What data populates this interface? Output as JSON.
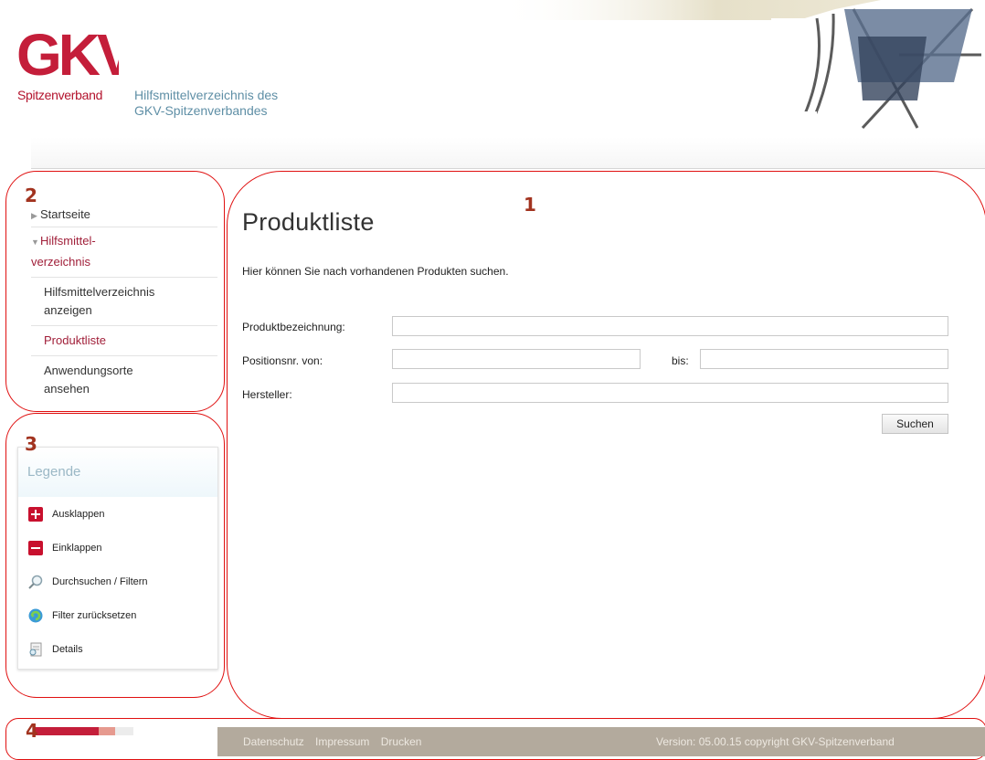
{
  "header": {
    "logo_text": "GKV",
    "org_name": "Spitzenverband",
    "site_title_line1": "Hilfsmittelverzeichnis des",
    "site_title_line2": "GKV-Spitzenverbandes"
  },
  "annotations": [
    "1",
    "2",
    "3",
    "4"
  ],
  "sidebar": {
    "items": [
      {
        "label": "Startseite",
        "state": "collapsed"
      },
      {
        "label_line1": "Hilfsmittel-",
        "label_line2": "verzeichnis",
        "state": "expanded"
      },
      {
        "label_line1": "Hilfsmittelverzeichnis",
        "label_line2": "anzeigen"
      },
      {
        "label": "Produktliste",
        "state": "active"
      },
      {
        "label_line1": "Anwendungsorte",
        "label_line2": "ansehen"
      }
    ]
  },
  "legend": {
    "title": "Legende",
    "items": [
      {
        "icon": "plus-icon",
        "label": "Ausklappen"
      },
      {
        "icon": "minus-icon",
        "label": "Einklappen"
      },
      {
        "icon": "magnifier-icon",
        "label": "Durchsuchen / Filtern"
      },
      {
        "icon": "refresh-icon",
        "label": "Filter zurücksetzen"
      },
      {
        "icon": "details-icon",
        "label": "Details"
      }
    ]
  },
  "main": {
    "title": "Produktliste",
    "intro": "Hier können Sie nach vorhandenen Produkten suchen.",
    "form": {
      "product_label": "Produktbezeichnung:",
      "product_value": "",
      "position_from_label": "Positionsnr. von:",
      "position_from_value": "",
      "position_to_label": "bis:",
      "position_to_value": "",
      "manufacturer_label": "Hersteller:",
      "manufacturer_value": "",
      "search_button": "Suchen"
    }
  },
  "footer": {
    "links": [
      "Datenschutz",
      "Impressum",
      "Drucken"
    ],
    "version": "Version: 05.00.15  copyright GKV-Spitzenverband"
  },
  "colors": {
    "brand_red": "#c41e3a",
    "title_blue": "#5f8fa6",
    "annotation_red": "#e01010",
    "footer_bg": "#b3aa9d"
  }
}
